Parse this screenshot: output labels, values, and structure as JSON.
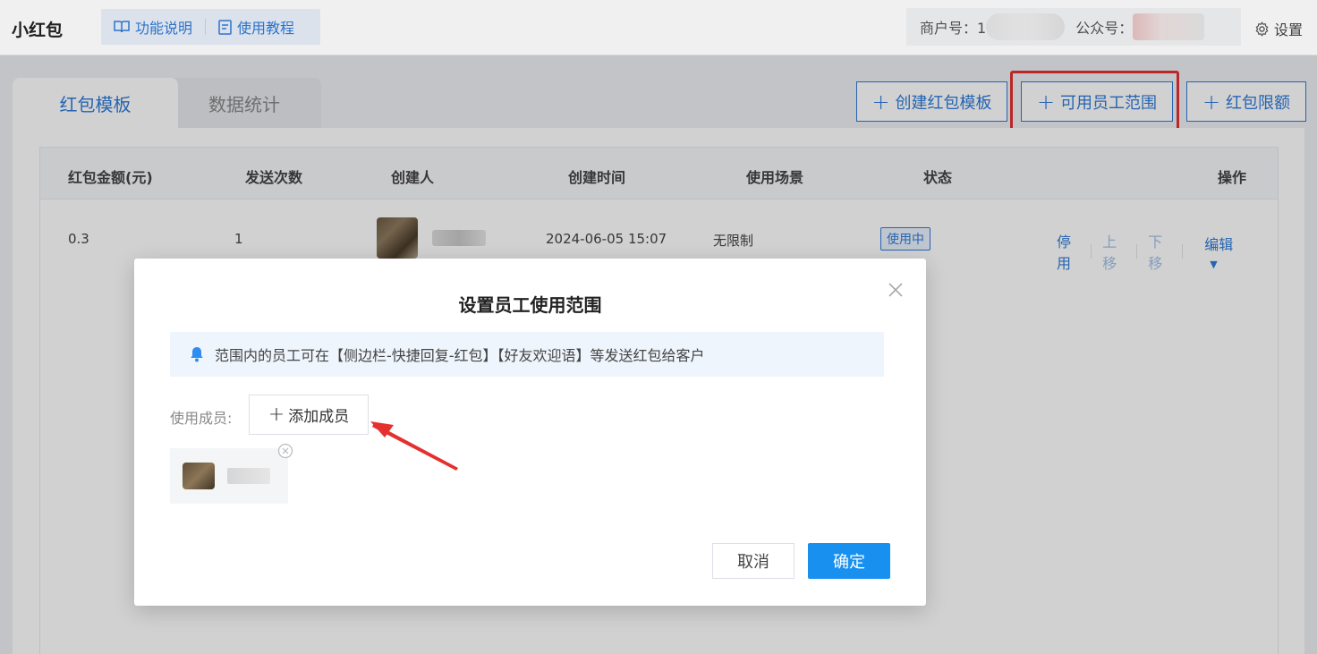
{
  "header": {
    "app_title": "小红包",
    "help_links": [
      {
        "label": "功能说明",
        "icon": "book-icon"
      },
      {
        "label": "使用教程",
        "icon": "doc-icon"
      }
    ],
    "merchant_label": "商户号：1",
    "official_account_label": "公众号：",
    "settings_label": "设置"
  },
  "tabs": [
    {
      "label": "红包模板",
      "active": true
    },
    {
      "label": "数据统计",
      "active": false
    }
  ],
  "actions": {
    "create_template": "创建红包模板",
    "staff_scope": "可用员工范围",
    "limit": "红包限额"
  },
  "table": {
    "columns": [
      "红包金额(元)",
      "发送次数",
      "创建人",
      "创建时间",
      "使用场景",
      "状态",
      "操作"
    ],
    "rows": [
      {
        "amount": "0.3",
        "count": "1",
        "created_at": "2024-06-05 15:07",
        "scene": "无限制",
        "status": "使用中"
      }
    ],
    "row_ops": [
      "停用",
      "上移",
      "下移",
      "编辑"
    ]
  },
  "modal": {
    "title": "设置员工使用范围",
    "notice": "范围内的员工可在【侧边栏-快捷回复-红包】【好友欢迎语】等发送红包给客户",
    "member_label": "使用成员:",
    "add_member": "添加成员",
    "cancel": "取消",
    "confirm": "确定"
  },
  "colors": {
    "primary": "#2f7bd8",
    "confirm": "#1890f0",
    "highlight": "#e53030"
  }
}
